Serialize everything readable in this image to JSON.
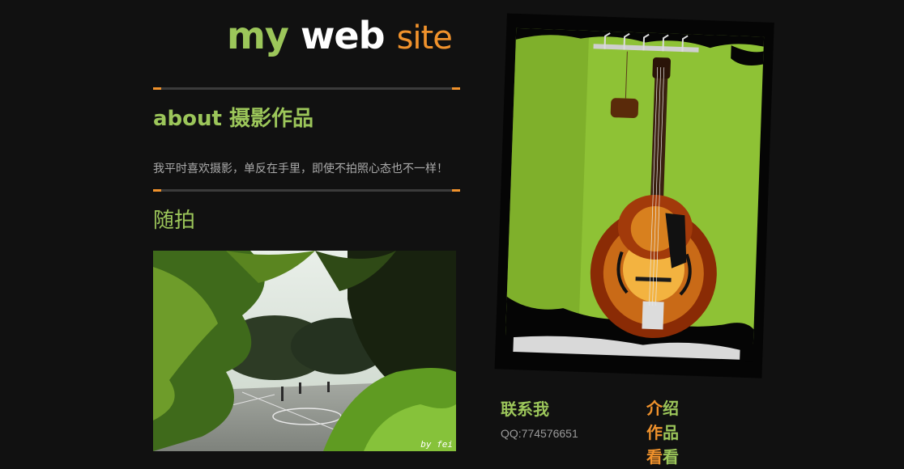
{
  "header": {
    "title_word1": "my",
    "title_word2": "web",
    "title_word3": "site"
  },
  "about": {
    "heading": "about 摄影作品",
    "intro": "我平时喜欢摄影，单反在手里，即使不拍照心态也不一样！"
  },
  "gallery": {
    "heading": "随拍",
    "photo_credit": "by fei"
  },
  "contact": {
    "title": "联系我",
    "qq": "QQ:774576651"
  },
  "nav": {
    "items": [
      {
        "first": "介",
        "rest": "绍"
      },
      {
        "first": "作",
        "rest": "品"
      },
      {
        "first": "看",
        "rest": "看"
      }
    ]
  },
  "colors": {
    "green": "#9cc65a",
    "orange": "#f0922c",
    "background": "#111111"
  }
}
